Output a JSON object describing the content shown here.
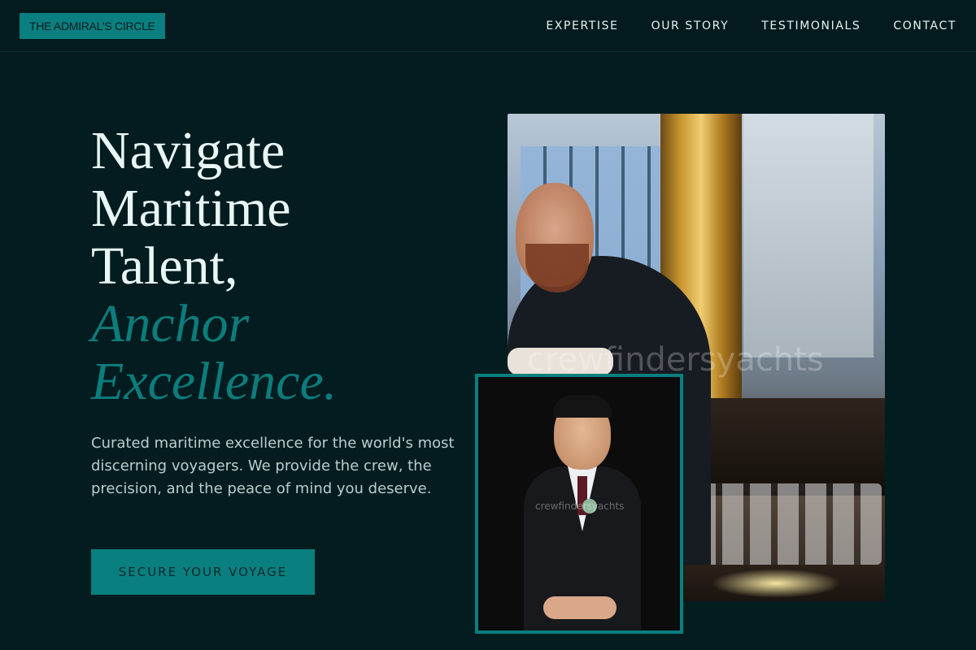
{
  "header": {
    "logo": "THE ADMIRAL'S CIRCLE",
    "nav": [
      "EXPERTISE",
      "OUR STORY",
      "TESTIMONIALS",
      "CONTACT"
    ]
  },
  "hero": {
    "headline_plain": [
      "Navigate",
      "Maritime",
      "Talent,"
    ],
    "headline_accent": [
      "Anchor",
      "Excellence."
    ],
    "lede": "Curated maritime excellence for the world's most discerning voyagers. We provide the crew, the precision, and the peace of mind you deserve.",
    "cta_label": "SECURE YOUR VOYAGE"
  },
  "photos": {
    "main_watermark": "crewfindersyachts",
    "inset_watermark": "crewfindersyachts"
  },
  "colors": {
    "background": "#021c1f",
    "accent": "#0a7f7f",
    "text": "#e6f2f0"
  }
}
